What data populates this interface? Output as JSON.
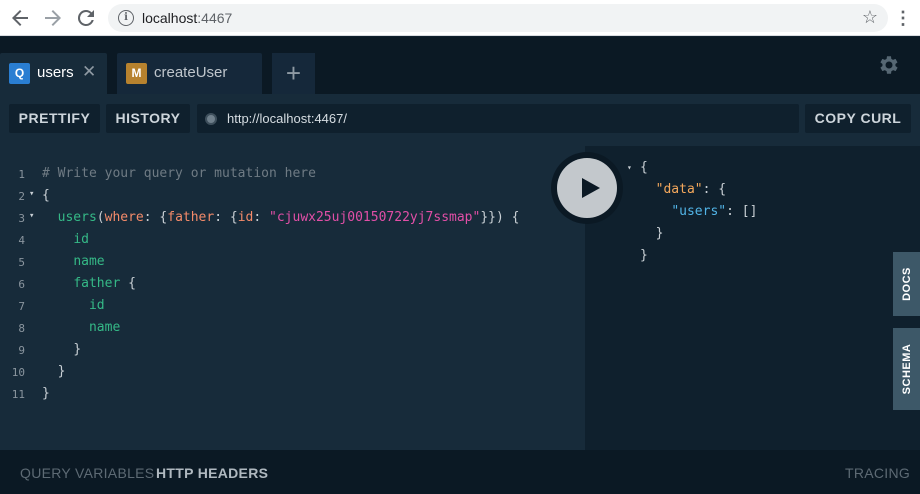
{
  "browser": {
    "back_icon": "back-arrow-icon",
    "forward_icon": "forward-arrow-icon",
    "reload_icon": "reload-icon",
    "url_host": "localhost",
    "url_port": ":4467",
    "star_icon": "bookmark-star-icon",
    "menu_icon": "kebab-menu-icon"
  },
  "tabs": [
    {
      "badge": "Q",
      "label": "users",
      "close": "✕"
    },
    {
      "badge": "M",
      "label": "createUser"
    }
  ],
  "add_tab": "+",
  "toolbar": {
    "prettify": "PRETTIFY",
    "history": "HISTORY",
    "endpoint": "http://localhost:4467/",
    "copy_curl": "COPY CURL"
  },
  "editor": {
    "line_numbers": [
      "1",
      "2",
      "3",
      "4",
      "5",
      "6",
      "7",
      "8",
      "9",
      "10",
      "11"
    ],
    "comment": "# Write your query or mutation here",
    "open_brace": "{",
    "users_field": "users",
    "where_arg": "where",
    "father_arg": "father",
    "id_arg": "id",
    "id_value": "\"cjuwx25uj00150722yj7ssmap\"",
    "field_id": "id",
    "field_name": "name",
    "field_father": "father",
    "close_brace": "}"
  },
  "result": {
    "data_key": "\"data\"",
    "users_key": "\"users\"",
    "users_value": "[]"
  },
  "side_tabs": {
    "docs": "DOCS",
    "schema": "SCHEMA"
  },
  "bottom": {
    "query_variables": "QUERY VARIABLES",
    "http_headers": "HTTP HEADERS",
    "tracing": "TRACING"
  },
  "colors": {
    "background": "#0f202d",
    "editor_bg": "#172b3a",
    "field_green": "#35b987",
    "string_pink": "#e24fa7",
    "arg_orange": "#f48b6a",
    "json_key": "#f4a85c"
  }
}
